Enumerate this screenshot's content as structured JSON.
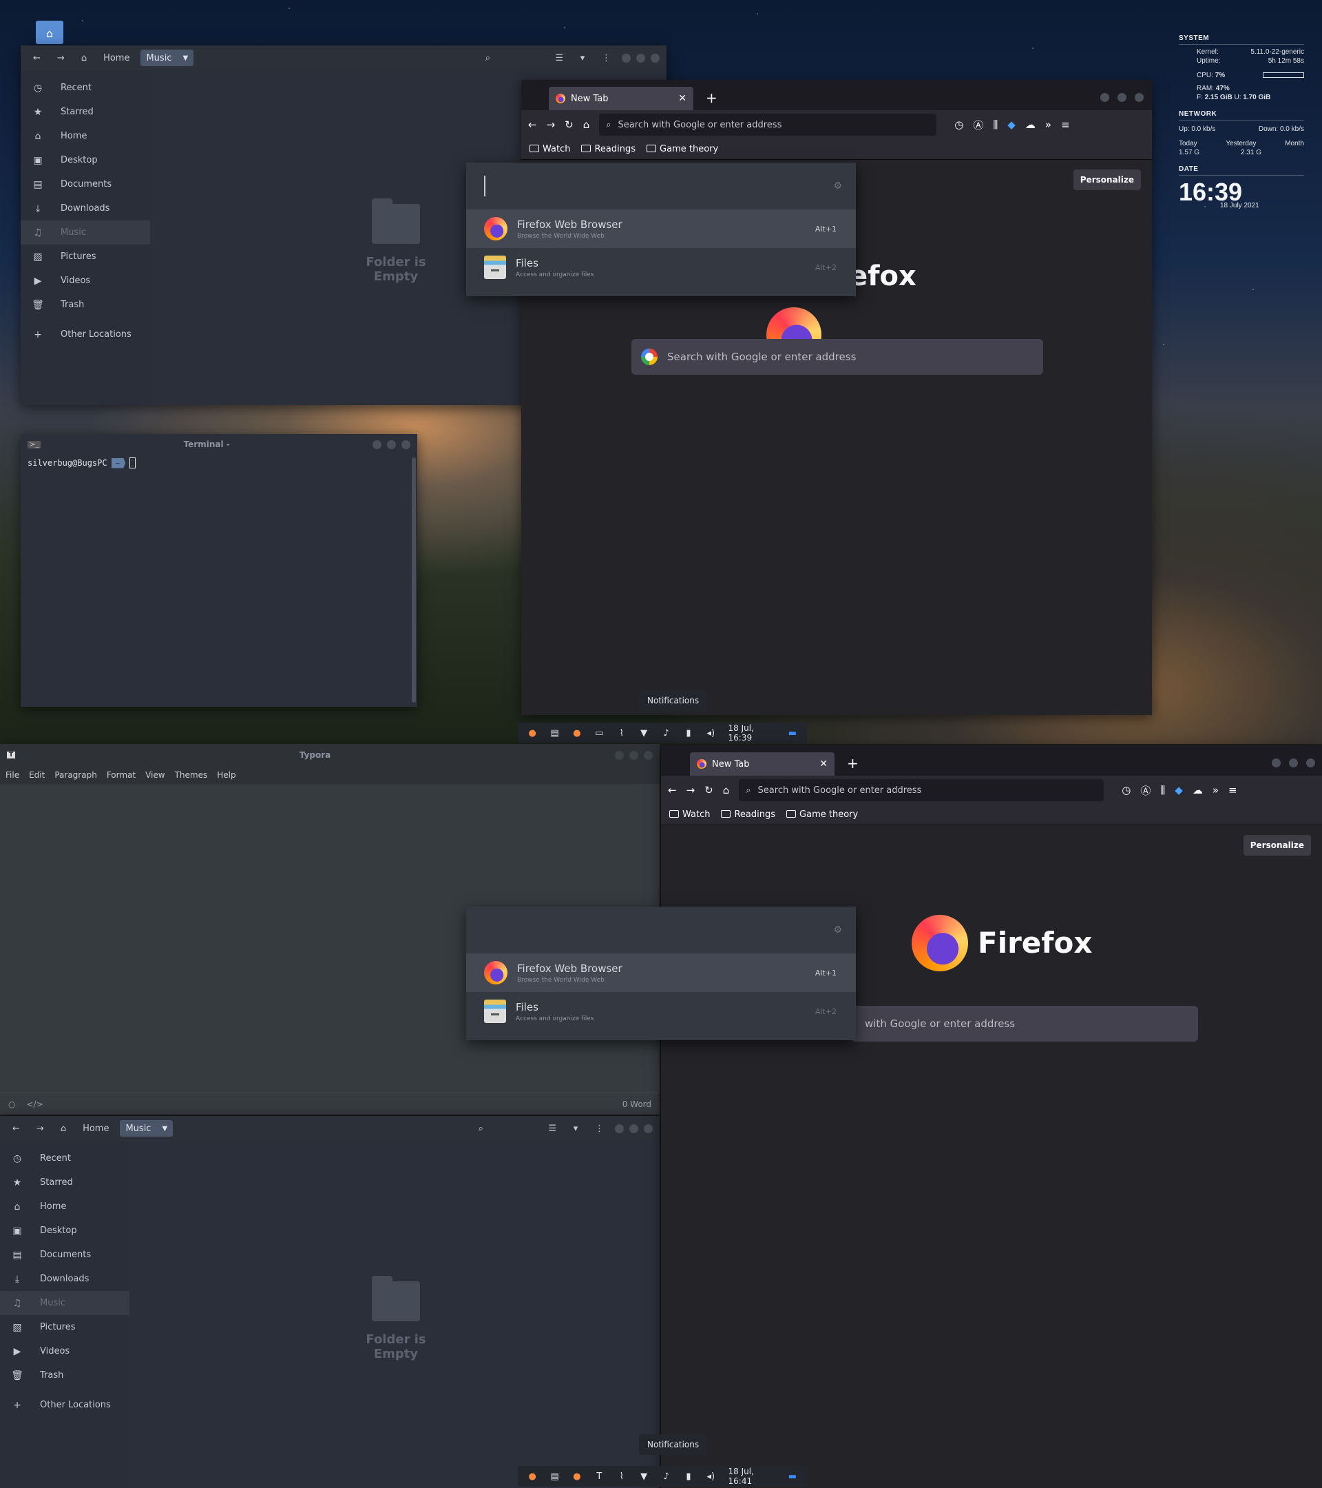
{
  "files": {
    "crumb_home": "Home",
    "crumb_music": "Music",
    "empty_text": "Folder is Empty",
    "sidebar": [
      {
        "label": "Recent",
        "icon": "clock-icon",
        "glyph": "◷"
      },
      {
        "label": "Starred",
        "icon": "star-icon",
        "glyph": "★"
      },
      {
        "label": "Home",
        "icon": "home-icon",
        "glyph": "⌂"
      },
      {
        "label": "Desktop",
        "icon": "desktop-icon",
        "glyph": "▣"
      },
      {
        "label": "Documents",
        "icon": "document-icon",
        "glyph": "▤"
      },
      {
        "label": "Downloads",
        "icon": "download-icon",
        "glyph": "⤓"
      },
      {
        "label": "Music",
        "icon": "music-icon",
        "glyph": "♫",
        "active": true
      },
      {
        "label": "Pictures",
        "icon": "picture-icon",
        "glyph": "▨"
      },
      {
        "label": "Videos",
        "icon": "video-icon",
        "glyph": "▶"
      },
      {
        "label": "Trash",
        "icon": "trash-icon",
        "glyph": "🗑"
      }
    ],
    "other_locations": "Other Locations"
  },
  "firefox": {
    "tab_title": "New Tab",
    "url_placeholder": "Search with Google or enter address",
    "bookmarks": [
      "Watch",
      "Readings",
      "Game theory"
    ],
    "personalize": "Personalize",
    "brand_partial": "efox",
    "brand": "Firefox",
    "search_placeholder": "Search with Google or enter address",
    "search_placeholder_partial": "with Google or enter address"
  },
  "launcher": {
    "items": [
      {
        "title": "Firefox Web Browser",
        "subtitle": "Browse the World Wide Web",
        "accel": "Alt+1"
      },
      {
        "title": "Files",
        "subtitle": "Access and organize files",
        "accel": "Alt+2"
      }
    ]
  },
  "terminal": {
    "title": "Terminal -",
    "user": "silverbug@BugsPC",
    "dir": "~"
  },
  "panel": {
    "time_top": "18 Jul, 16:39",
    "time_bottom": "18 Jul, 16:41",
    "tooltip": "Notifications"
  },
  "conky": {
    "system": "SYSTEM",
    "kernel_label": "Kernel:",
    "kernel": "5.11.0-22-generic",
    "uptime_label": "Uptime:",
    "uptime": "5h 12m 58s",
    "cpu_label": "CPU:",
    "cpu": "7%",
    "ram_label": "RAM:",
    "ram": "47%",
    "free_label": "F:",
    "free": "2.15 GiB",
    "used_label": "U:",
    "used": "1.70 GiB",
    "network": "NETWORK",
    "up": "Up: 0.0 kb/s",
    "down": "Down: 0.0 kb/s",
    "today_label": "Today",
    "today": "1.57 G",
    "yesterday_label": "Yesterday",
    "yesterday": "2.31 G",
    "month_label": "Month",
    "date_hd": "DATE",
    "time": "16:39",
    "date": "18 July 2021"
  },
  "typora": {
    "title": "Typora",
    "menu": [
      "File",
      "Edit",
      "Paragraph",
      "Format",
      "View",
      "Themes",
      "Help"
    ],
    "words": "0 Word"
  }
}
